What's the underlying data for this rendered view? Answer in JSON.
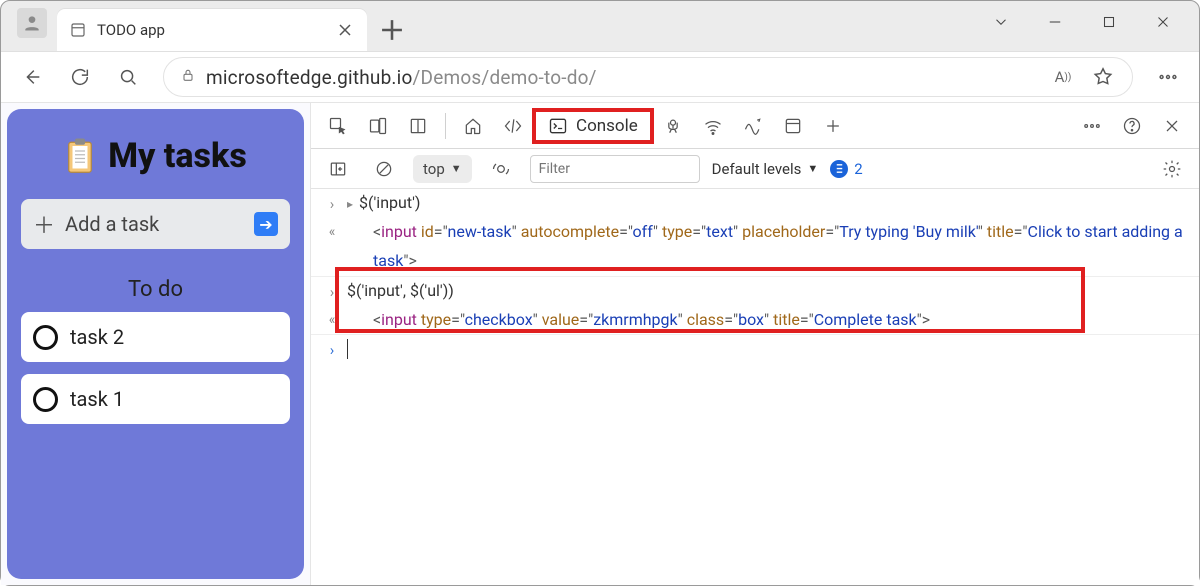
{
  "tab": {
    "title": "TODO app"
  },
  "url": {
    "host": "microsoftedge.github.io",
    "path": "/Demos/demo-to-do/"
  },
  "app": {
    "title": "My tasks",
    "add_label": "Add a task",
    "todo_header": "To do",
    "tasks": [
      "task 2",
      "task 1"
    ]
  },
  "devtools": {
    "active_tab": "Console",
    "context": "top",
    "filter_placeholder": "Filter",
    "levels_label": "Default levels",
    "issues_count": "2",
    "lines": {
      "l1_expr": "$('input')",
      "l2_tag": "input",
      "l2_attrs": [
        {
          "n": "id",
          "v": "new-task"
        },
        {
          "n": "autocomplete",
          "v": "off"
        },
        {
          "n": "type",
          "v": "text"
        },
        {
          "n": "placeholder",
          "v": "Try typing 'Buy milk'"
        },
        {
          "n": "title",
          "v": "Click to start adding a task"
        }
      ],
      "l3_expr": "$('input', $('ul'))",
      "l4_tag": "input",
      "l4_attrs": [
        {
          "n": "type",
          "v": "checkbox"
        },
        {
          "n": "value",
          "v": "zkmrmhpgk"
        },
        {
          "n": "class",
          "v": "box"
        },
        {
          "n": "title",
          "v": "Complete task"
        }
      ]
    }
  }
}
